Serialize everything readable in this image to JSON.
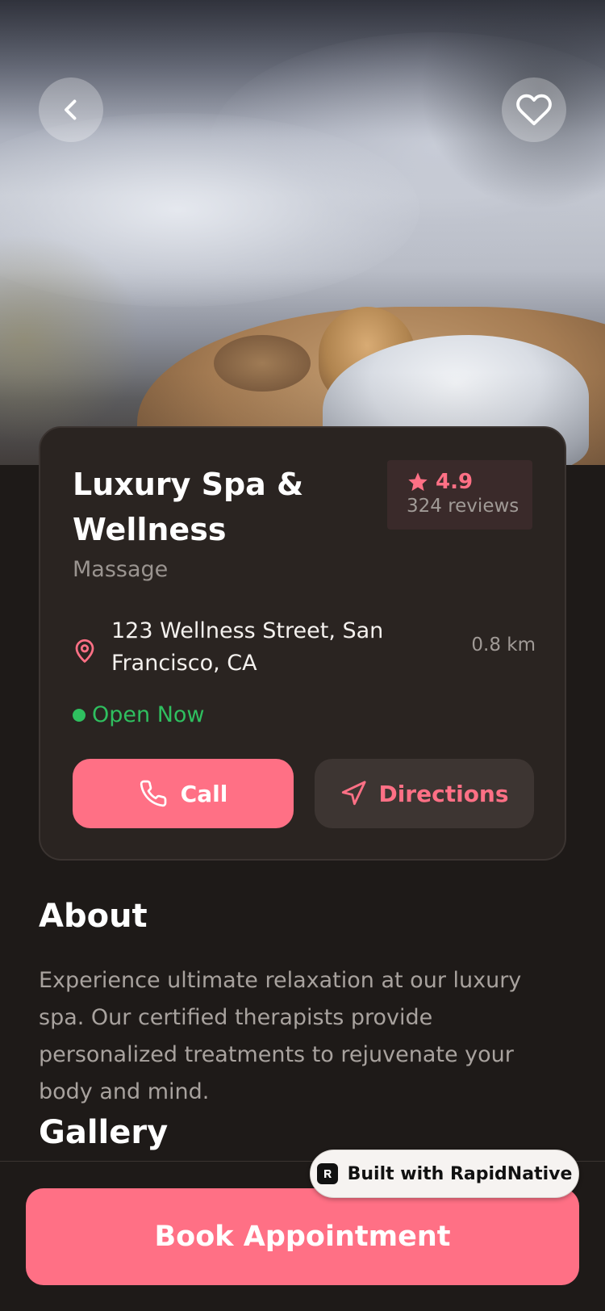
{
  "hero": {
    "image_alt": "spa treatment photo"
  },
  "header": {
    "back_icon": "chevron-left-icon",
    "favorite_icon": "heart-icon"
  },
  "business": {
    "name": "Luxury Spa & Wellness",
    "category": "Massage",
    "rating": "4.9",
    "reviews": "324 reviews",
    "address": "123 Wellness Street, San Francisco, CA",
    "distance": "0.8 km",
    "status": "Open Now"
  },
  "actions": {
    "call_label": "Call",
    "directions_label": "Directions"
  },
  "about": {
    "title": "About",
    "text": "Experience ultimate relaxation at our luxury spa. Our certified therapists provide personalized treatments to rejuvenate your body and mind."
  },
  "gallery": {
    "title": "Gallery"
  },
  "footer": {
    "book_label": "Book Appointment",
    "badge_label": "Built with RapidNative"
  },
  "colors": {
    "accent": "#ff7085",
    "background": "#1e1a18",
    "card": "#2a2421",
    "open": "#2fbf5f"
  }
}
